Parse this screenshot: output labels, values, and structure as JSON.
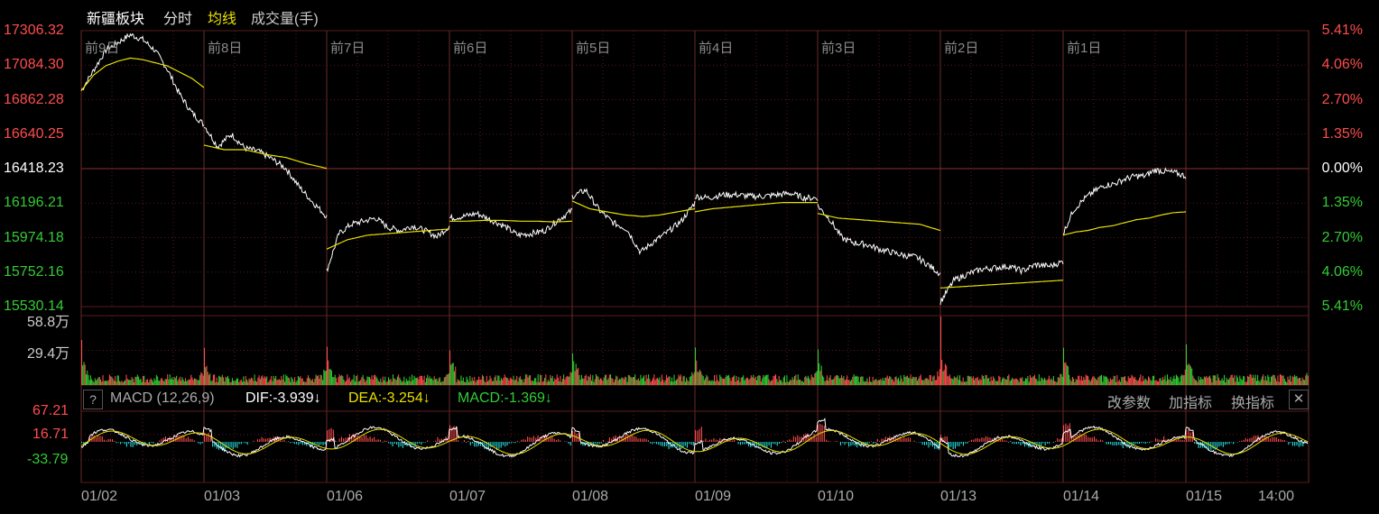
{
  "header": {
    "title": "新疆板块",
    "tab_fenshi": "分时",
    "tab_junxian": "均线",
    "tab_volume": "成交量(手)"
  },
  "price_axis": {
    "left_labels": [
      "17306.32",
      "17084.30",
      "16862.28",
      "16640.25",
      "16418.23",
      "16196.21",
      "15974.18",
      "15752.16",
      "15530.14"
    ],
    "right_labels": [
      "5.41%",
      "4.06%",
      "2.70%",
      "1.35%",
      "0.00%",
      "1.35%",
      "2.70%",
      "4.06%",
      "5.41%"
    ],
    "up_color": "#ff4d4d",
    "base_color": "#ffffff",
    "down_color": "#33cc33"
  },
  "day_labels": [
    "前9日",
    "前8日",
    "前7日",
    "前6日",
    "前5日",
    "前4日",
    "前3日",
    "前2日",
    "前1日"
  ],
  "volume_axis": {
    "top": "58.8万",
    "mid": "29.4万"
  },
  "macd": {
    "help": "?",
    "name": "MACD (12,26,9)",
    "dif": "DIF:-3.939↓",
    "dea": "DEA:-3.254↓",
    "macd": "MACD:-1.369↓",
    "axis": [
      "67.21",
      "16.71",
      "-33.79"
    ],
    "btn_params": "改参数",
    "btn_add": "加指标",
    "btn_switch": "换指标",
    "btn_close": "✕"
  },
  "x_labels": [
    "01/02",
    "01/03",
    "01/06",
    "01/07",
    "01/08",
    "01/09",
    "01/10",
    "01/13",
    "01/14",
    "01/15",
    "14:00"
  ],
  "colors": {
    "price_line": "#ffffff",
    "avg_line": "#e8e000",
    "grid": "#5a1a1a",
    "up": "#ff4d4d",
    "down": "#33cc33",
    "dif": "#ffffff",
    "dea": "#e8e000",
    "macd_neg": "#22e0e0"
  },
  "chart_data": {
    "type": "line",
    "title": "新疆板块",
    "unit": "index",
    "ylim": [
      15530.14,
      17306.32
    ],
    "base": 16418.23,
    "series": [
      {
        "name": "price",
        "segments": [
          [
            16920,
            17050,
            17180,
            17230,
            17280,
            17250,
            17180,
            17060,
            16900,
            16780,
            16700
          ],
          [
            16700,
            16560,
            16640,
            16550,
            16530,
            16480,
            16420,
            16300,
            16200,
            16110
          ],
          [
            15760,
            16000,
            16060,
            16080,
            16100,
            16040,
            16020,
            16050,
            16020,
            15980,
            16050
          ],
          [
            16100,
            16110,
            16130,
            16090,
            16050,
            15990,
            16000,
            16020,
            16090,
            16150
          ],
          [
            16240,
            16280,
            16150,
            16070,
            16030,
            15880,
            15950,
            16010,
            16080,
            16200
          ],
          [
            16240,
            16230,
            16250,
            16250,
            16240,
            16240,
            16250,
            16260,
            16230,
            16230
          ],
          [
            16180,
            16090,
            15970,
            15940,
            15930,
            15900,
            15880,
            15860,
            15850,
            15800,
            15740
          ],
          [
            15560,
            15700,
            15740,
            15770,
            15780,
            15790,
            15760,
            15800,
            15790,
            15820
          ],
          [
            16000,
            16150,
            16220,
            16270,
            16310,
            16320,
            16350,
            16370,
            16370,
            16410,
            16400,
            16390,
            16370
          ]
        ]
      },
      {
        "name": "avg",
        "segments": [
          [
            16920,
            17020,
            17080,
            17110,
            17130,
            17120,
            17100,
            17080,
            17040,
            17000,
            16940
          ],
          [
            16570,
            16540,
            16540,
            16510,
            16490,
            16450,
            16420
          ],
          [
            15900,
            15960,
            15990,
            16000,
            16010,
            16020,
            16030
          ],
          [
            16080,
            16080,
            16085,
            16085,
            16080,
            16080,
            16075,
            16080
          ],
          [
            16210,
            16160,
            16140,
            16120,
            16110,
            16120,
            16140,
            16160
          ],
          [
            16140,
            16160,
            16170,
            16180,
            16190,
            16200,
            16200,
            16200
          ],
          [
            16130,
            16100,
            16090,
            16080,
            16070,
            16060,
            16020
          ],
          [
            15650,
            15660,
            15670,
            15680,
            15690,
            15700
          ],
          [
            15990,
            16010,
            16020,
            16040,
            16050,
            16070,
            16090,
            16100,
            16120,
            16135,
            16140
          ]
        ]
      }
    ]
  }
}
